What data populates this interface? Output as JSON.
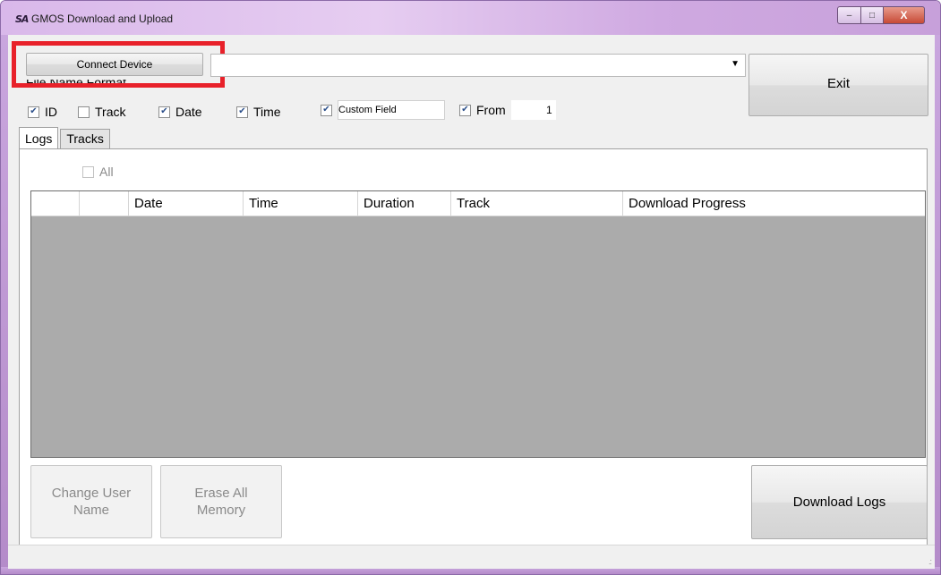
{
  "window": {
    "logo": "SA",
    "title": "GMOS Download and Upload",
    "controls": {
      "minimize": "–",
      "maximize": "□",
      "close": "X"
    }
  },
  "toolbar": {
    "connect_label": "Connect Device",
    "device_value": "",
    "exit_label": "Exit"
  },
  "file_name_format": {
    "label": "File Name Format",
    "options": [
      {
        "label": "ID",
        "checked": true
      },
      {
        "label": "Track",
        "checked": false
      },
      {
        "label": "Date",
        "checked": true
      },
      {
        "label": "Time",
        "checked": true
      },
      {
        "label": "Custom Field",
        "checked": true
      },
      {
        "label": "From",
        "checked": true
      }
    ],
    "from_value": "1"
  },
  "tabs": [
    {
      "label": "Logs",
      "active": true
    },
    {
      "label": "Tracks",
      "active": false
    }
  ],
  "logs": {
    "all_label": "All",
    "columns": [
      "",
      "",
      "Date",
      "Time",
      "Duration",
      "Track",
      "Download Progress"
    ],
    "rows": []
  },
  "buttons": {
    "change_user": "Change User\nName",
    "erase_all": "Erase All\nMemory",
    "download_logs": "Download Logs"
  },
  "colors": {
    "highlight": "#e8212a",
    "grid_background": "#ababab",
    "frame": "#c9a6de"
  },
  "icons": {
    "checkbox_checked": "check-icon",
    "dropdown": "chevron-down-icon",
    "resize_grip": "resize-grip-icon"
  }
}
